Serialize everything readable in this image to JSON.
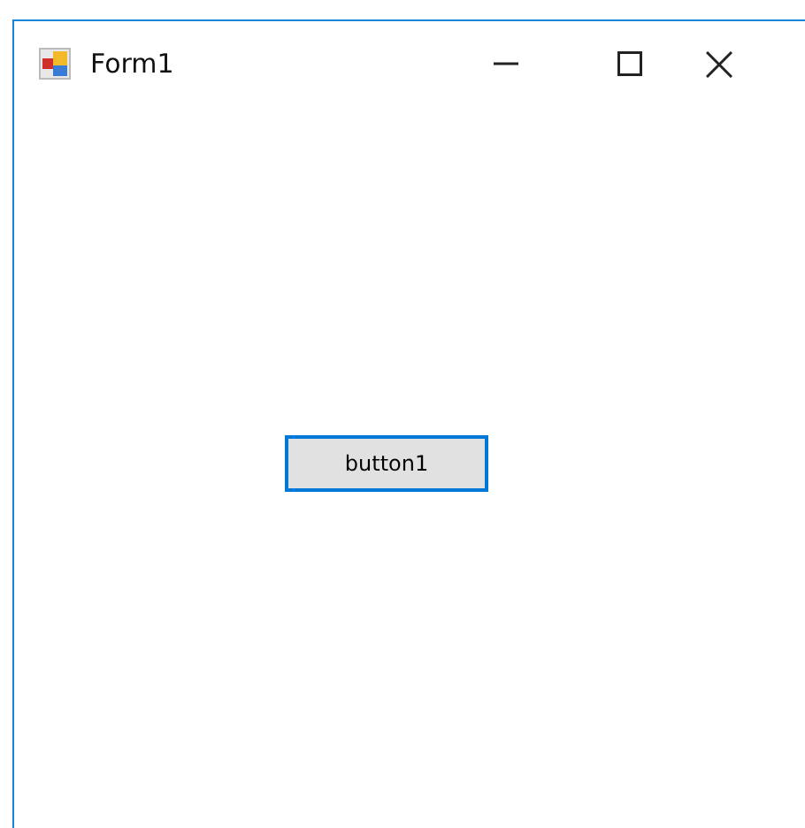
{
  "window": {
    "title": "Form1"
  },
  "caption_buttons": [
    {
      "kind": "minimize"
    },
    {
      "kind": "maximize"
    },
    {
      "kind": "close"
    }
  ],
  "button": {
    "label": "button1",
    "focused": true
  }
}
